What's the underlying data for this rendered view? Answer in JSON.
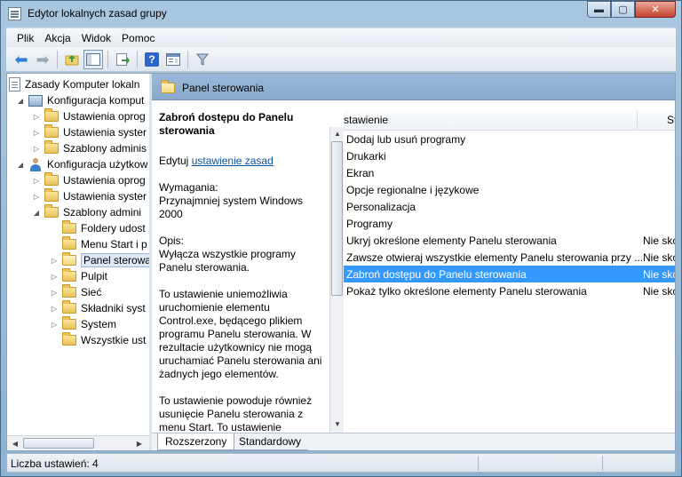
{
  "window": {
    "title": "Edytor lokalnych zasad grupy"
  },
  "caption": {
    "minimize": "▬",
    "maximize": "▢",
    "close": "✕"
  },
  "menu": [
    "Plik",
    "Akcja",
    "Widok",
    "Pomoc"
  ],
  "tree": {
    "items": [
      {
        "label": "Zasady Komputer lokaln",
        "icon": "policy-doc-icon",
        "expander": ""
      },
      {
        "label": "Konfiguracja komput",
        "icon": "computer-icon",
        "expander": "◢"
      },
      {
        "label": "Ustawienia oprog",
        "icon": "folder-icon",
        "expander": "▷"
      },
      {
        "label": "Ustawienia syster",
        "icon": "folder-icon",
        "expander": "▷"
      },
      {
        "label": "Szablony adminis",
        "icon": "folder-icon",
        "expander": "▷"
      },
      {
        "label": "Konfiguracja użytkow",
        "icon": "user-icon",
        "expander": "◢"
      },
      {
        "label": "Ustawienia oprog",
        "icon": "folder-icon",
        "expander": "▷"
      },
      {
        "label": "Ustawienia syster",
        "icon": "folder-icon",
        "expander": "▷"
      },
      {
        "label": "Szablony admini",
        "icon": "folder-icon",
        "expander": "◢"
      },
      {
        "label": "Foldery udost",
        "icon": "folder-icon",
        "expander": ""
      },
      {
        "label": "Menu Start i p",
        "icon": "folder-icon",
        "expander": ""
      },
      {
        "label": "Panel sterowa",
        "icon": "folder-open-icon",
        "expander": "▷"
      },
      {
        "label": "Pulpit",
        "icon": "folder-icon",
        "expander": "▷"
      },
      {
        "label": "Sieć",
        "icon": "folder-icon",
        "expander": "▷"
      },
      {
        "label": "Składniki syst",
        "icon": "folder-icon",
        "expander": "▷"
      },
      {
        "label": "System",
        "icon": "folder-icon",
        "expander": "▷"
      },
      {
        "label": "Wszystkie ust",
        "icon": "all-settings-icon",
        "expander": ""
      }
    ]
  },
  "header": {
    "title": "Panel sterowania"
  },
  "description": {
    "title": "Zabroń dostępu do Panelu sterowania",
    "edit_prefix": "Edytuj",
    "edit_link": "ustawienie zasad",
    "requirements_label": "Wymagania:",
    "requirements_text": "Przynajmniej system Windows 2000",
    "desc_label": "Opis:",
    "desc_text": "Wyłącza wszystkie programy Panelu sterowania.",
    "para2": "To ustawienie uniemożliwia uruchomienie elementu Control.exe, będącego plikiem programu Panelu sterowania. W rezultacie użytkownicy nie mogą uruchamiać Panelu sterowania ani żadnych jego elementów.",
    "para3": "To ustawienie powoduje również usunięcie Panelu sterowania z menu Start. To ustawienie"
  },
  "list": {
    "col_setting": "stawienie",
    "col_state": "St",
    "rows": [
      {
        "name": "Dodaj lub usuń programy",
        "state": ""
      },
      {
        "name": "Drukarki",
        "state": ""
      },
      {
        "name": "Ekran",
        "state": ""
      },
      {
        "name": "Opcje regionalne i językowe",
        "state": ""
      },
      {
        "name": "Personalizacja",
        "state": ""
      },
      {
        "name": "Programy",
        "state": ""
      },
      {
        "name": "Ukryj określone elementy Panelu sterowania",
        "state": "Nie skon"
      },
      {
        "name": "Zawsze otwieraj wszystkie elementy Panelu sterowania przy ...",
        "state": "Nie skon"
      },
      {
        "name": "Zabroń dostępu do Panelu sterowania",
        "state": "Nie skon"
      },
      {
        "name": "Pokaż tylko określone elementy Panelu sterowania",
        "state": "Nie skon"
      }
    ]
  },
  "tabs": {
    "extended": "Rozszerzony",
    "standard": "Standardowy"
  },
  "status": {
    "text": "Liczba ustawień: 4"
  }
}
